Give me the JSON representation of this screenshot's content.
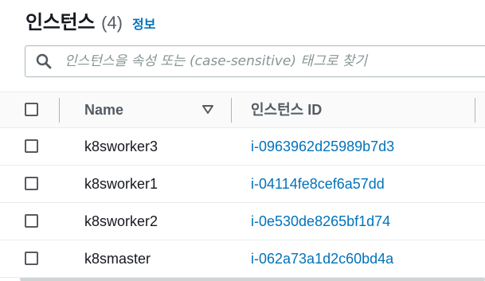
{
  "header": {
    "title": "인스턴스",
    "count": "(4)",
    "info_link": "정보"
  },
  "search": {
    "placeholder": "인스턴스을 속성 또는 (case-sensitive) 태그로 찾기",
    "value": ""
  },
  "table": {
    "columns": {
      "name": "Name",
      "instance_id": "인스턴스 ID"
    },
    "rows": [
      {
        "name": "k8sworker3",
        "instance_id": "i-0963962d25989b7d3"
      },
      {
        "name": "k8sworker1",
        "instance_id": "i-04114fe8cef6a57dd"
      },
      {
        "name": "k8sworker2",
        "instance_id": "i-0e530de8265bf1d74"
      },
      {
        "name": "k8smaster",
        "instance_id": "i-062a73a1d2c60bd4a"
      }
    ]
  },
  "colors": {
    "link": "#0073bb",
    "header_text": "#545b64",
    "border": "#aab7b8"
  }
}
